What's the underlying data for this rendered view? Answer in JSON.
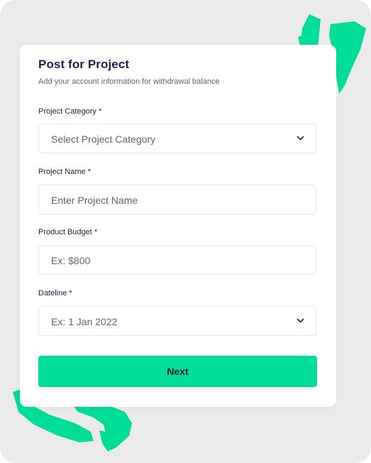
{
  "form": {
    "title": "Post for Project",
    "subtitle": "Add your account information for withdrawal balance",
    "fields": [
      {
        "label": "Project Category *",
        "placeholder": "Select Project Category",
        "icon": "chevron-down-icon"
      },
      {
        "label": "Project Name *",
        "placeholder": "Enter Project Name"
      },
      {
        "label": "Product Budget *",
        "placeholder": "Ex: $800"
      },
      {
        "label": "Dateline *",
        "placeholder": "Ex: 1 Jan 2022",
        "icon": "chevron-down-icon"
      }
    ],
    "next_label": "Next"
  },
  "colors": {
    "accent": "#00dd96",
    "background": "#ebebeb",
    "heading": "#16234a"
  }
}
